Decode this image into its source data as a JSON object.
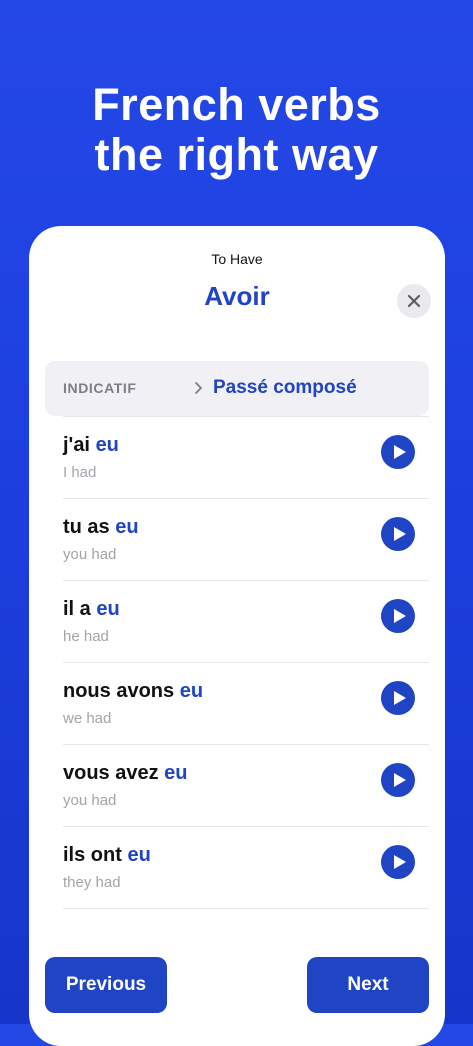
{
  "hero": {
    "line1": "French verbs",
    "line2": "the right way"
  },
  "header": {
    "subtitle": "To Have",
    "title": "Avoir",
    "close_icon": "close-icon"
  },
  "tense": {
    "mood": "INDICATIF",
    "chevron_icon": "chevron-right-icon",
    "name": "Passé composé"
  },
  "conjugations": [
    {
      "stem": "j'ai ",
      "ending": "eu",
      "translation": "I had"
    },
    {
      "stem": "tu as ",
      "ending": "eu",
      "translation": "you had"
    },
    {
      "stem": "il a ",
      "ending": "eu",
      "translation": "he had"
    },
    {
      "stem": "nous avons ",
      "ending": "eu",
      "translation": "we had"
    },
    {
      "stem": "vous avez ",
      "ending": "eu",
      "translation": "you had"
    },
    {
      "stem": "ils ont ",
      "ending": "eu",
      "translation": "they had"
    }
  ],
  "play_icon": "play-icon",
  "footer": {
    "previous_label": "Previous",
    "next_label": "Next"
  },
  "colors": {
    "background": "#1d3fe0",
    "accent": "#1f44c4",
    "card": "#ffffff",
    "muted_text": "#a3a3aa"
  }
}
